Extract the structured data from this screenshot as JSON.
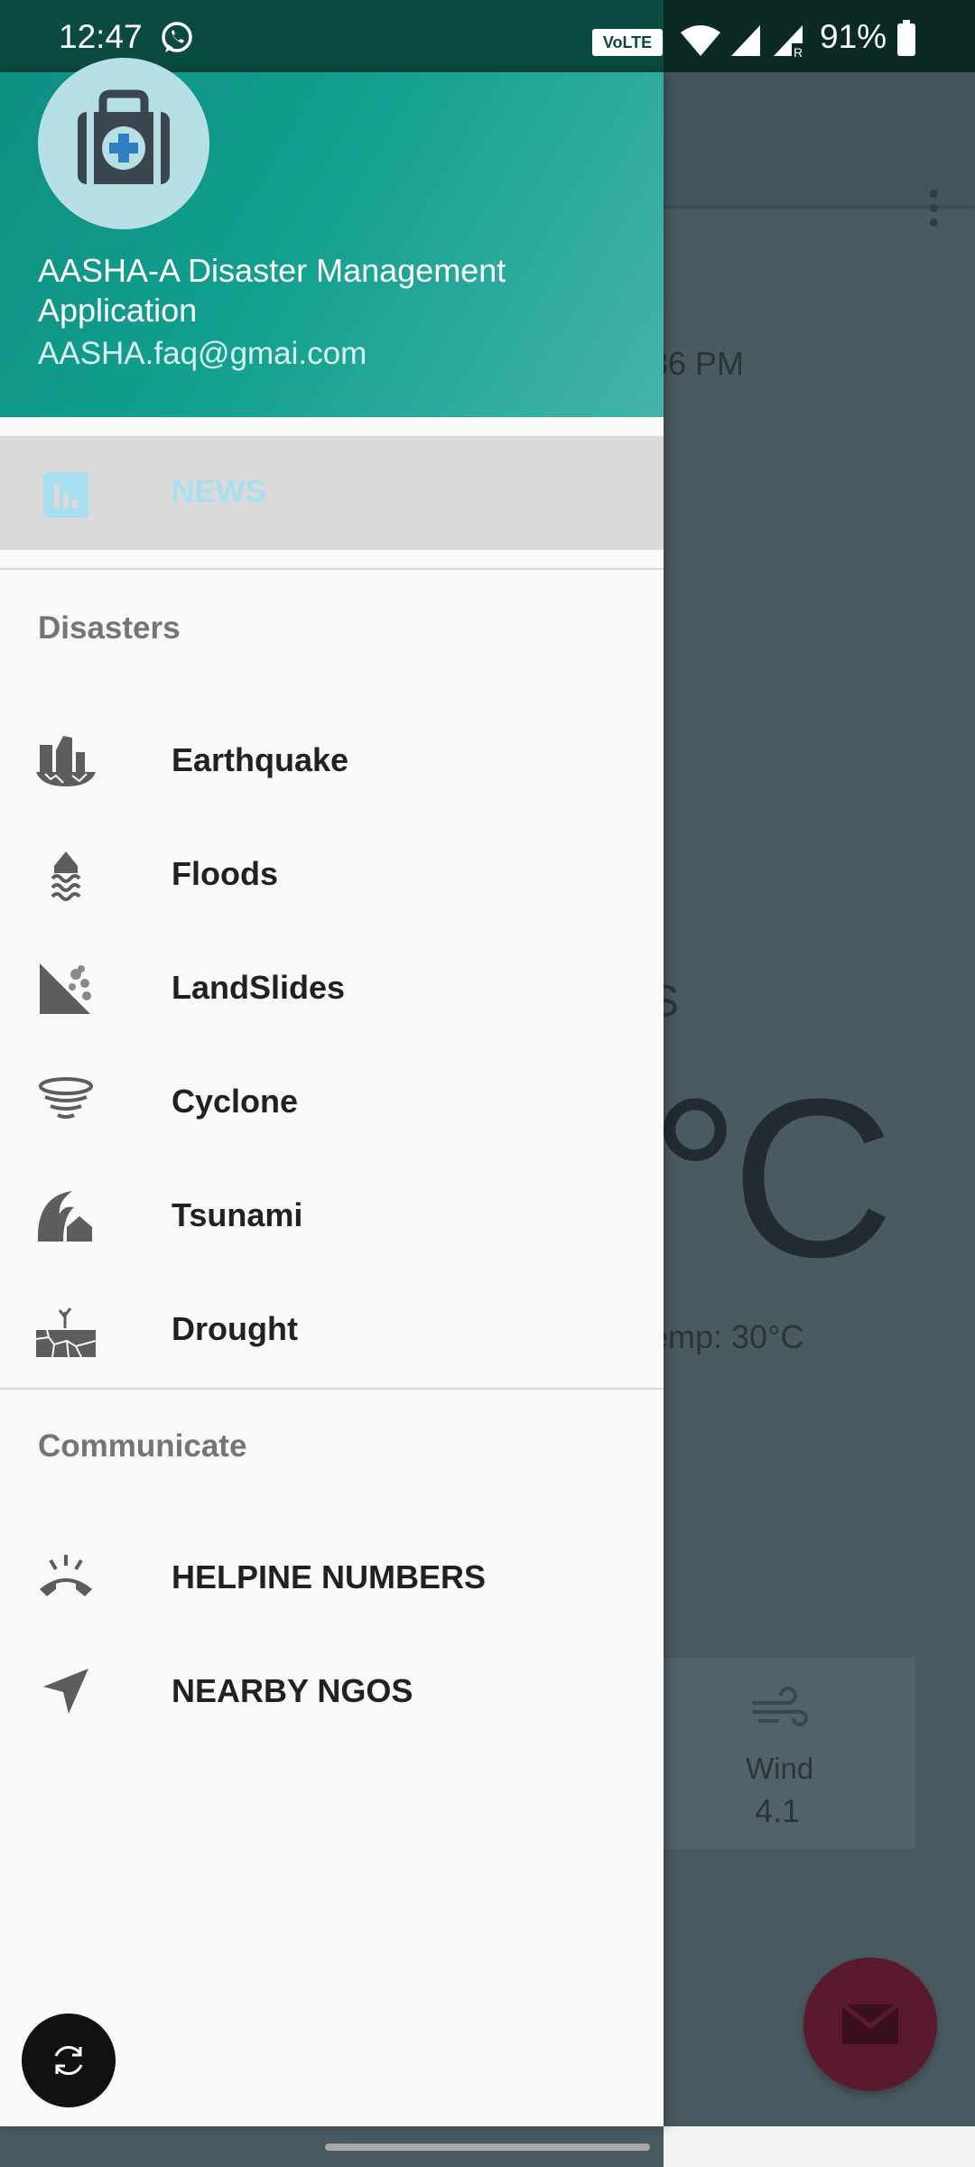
{
  "status_bar": {
    "time": "12:47",
    "volte": "VoLTE",
    "battery": "91%"
  },
  "drawer": {
    "app_name": "AASHA-A Disaster Management Application",
    "email": "AASHA.faq@gmai.com",
    "news_label": "NEWS",
    "disasters_title": "Disasters",
    "disasters": [
      {
        "label": "Earthquake",
        "icon": "earthquake-icon"
      },
      {
        "label": "Floods",
        "icon": "floods-icon"
      },
      {
        "label": "LandSlides",
        "icon": "landslides-icon"
      },
      {
        "label": "Cyclone",
        "icon": "cyclone-icon"
      },
      {
        "label": "Tsunami",
        "icon": "tsunami-icon"
      },
      {
        "label": "Drought",
        "icon": "drought-icon"
      }
    ],
    "communicate_title": "Communicate",
    "communicate": [
      {
        "label": "HELPINE NUMBERS",
        "icon": "phone-icon"
      },
      {
        "label": "NEARBY NGOS",
        "icon": "navigation-arrow-icon"
      }
    ]
  },
  "background": {
    "time_fragment": "36 PM",
    "city_fragment": "S",
    "temp_fragment": "°C",
    "feels_fragment": "emp: 30°C",
    "wind_label": "Wind",
    "wind_value": "4.1"
  },
  "colors": {
    "header_start": "#0e8f82",
    "header_end": "#45b3aa",
    "fab": "#5a1a2e"
  }
}
